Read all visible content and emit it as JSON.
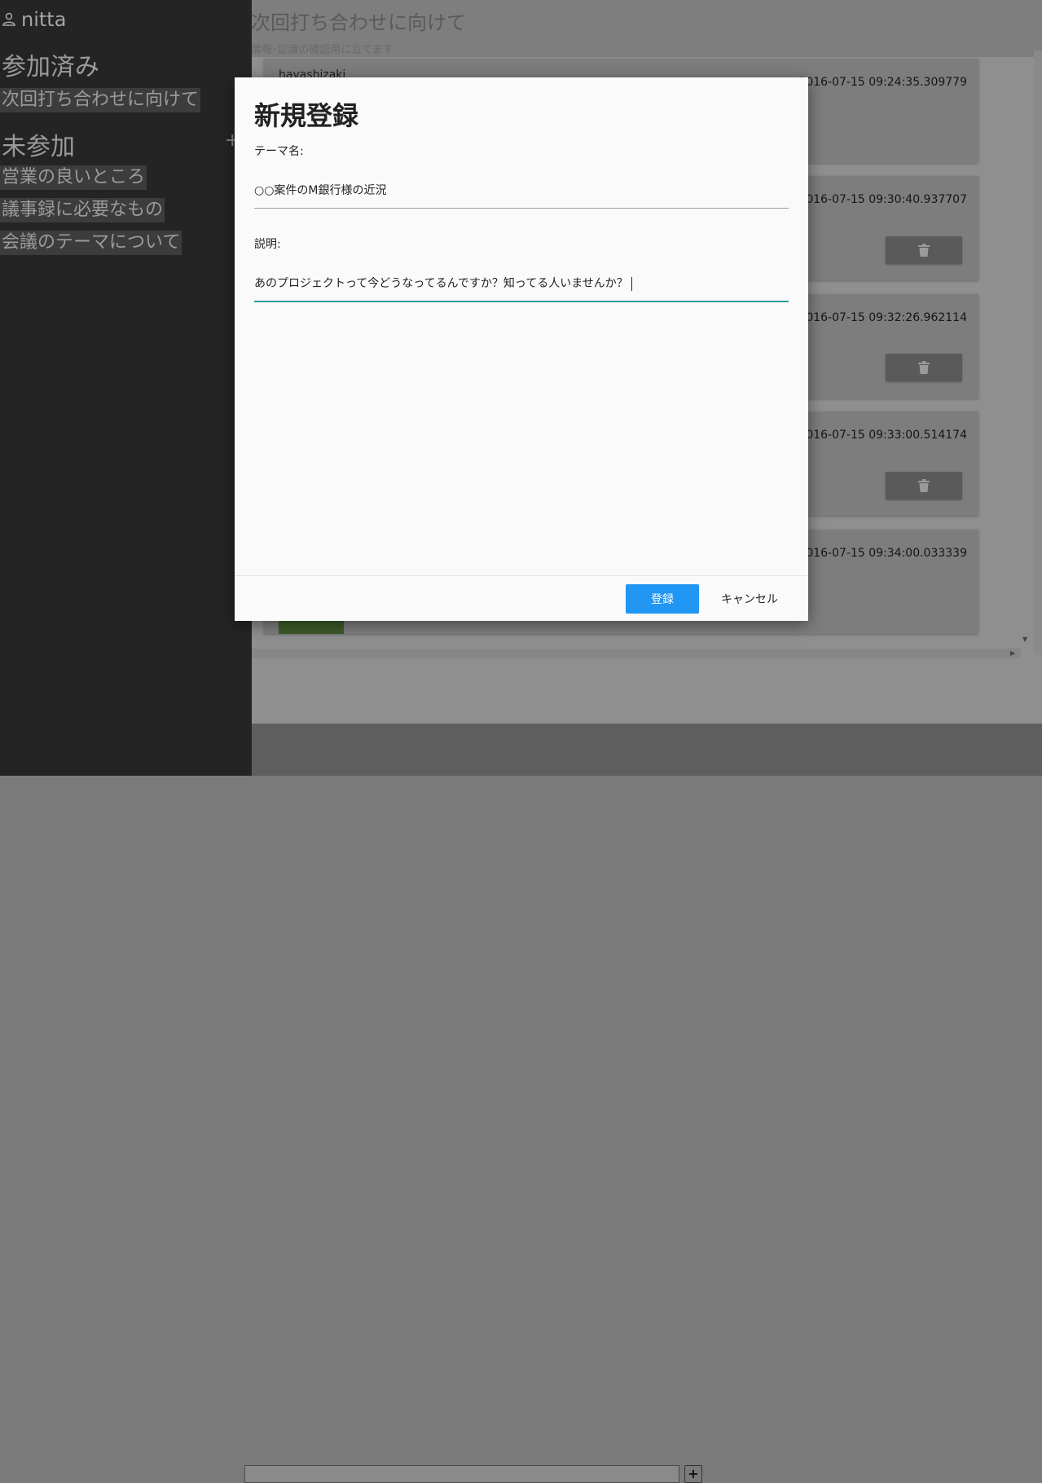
{
  "main": {
    "title": "次回打ち合わせに向けて",
    "subtitle": "情報･認識の確認用に立てます",
    "posts": [
      {
        "author": "havashizaki",
        "time": "2016-07-15 09:24:35.309779",
        "has_delete": false
      },
      {
        "author": "",
        "time": "2016-07-15 09:30:40.937707",
        "has_delete": true
      },
      {
        "author": "",
        "time": "2016-07-15 09:32:26.962114",
        "has_delete": true
      },
      {
        "author": "",
        "time": "2016-07-15 09:33:00.514174",
        "has_delete": true
      },
      {
        "author": "",
        "time": "2016-07-15 09:34:00.033339",
        "has_delete": false
      }
    ],
    "add_label": "+"
  },
  "sidebar": {
    "user_icon": "person-icon",
    "username": "nitta",
    "joined_title": "参加済み",
    "joined": [
      "次回打ち合わせに向けて"
    ],
    "unjoined_title": "未参加",
    "add_label": "+",
    "unjoined": [
      "営業の良いところ",
      "議事録に必要なもの",
      "会議のテーマについて"
    ]
  },
  "modal": {
    "title": "新規登録",
    "theme_label": "テーマ名:",
    "theme_value": "○○案件のM銀行様の近況",
    "desc_label": "説明:",
    "desc_value": "あのプロジェクトって今どうなってるんですか？知ってる人いませんか？",
    "submit_label": "登録",
    "cancel_label": "キャンセル",
    "accent_color": "#2196f3",
    "focus_color": "#2a9d9a"
  }
}
